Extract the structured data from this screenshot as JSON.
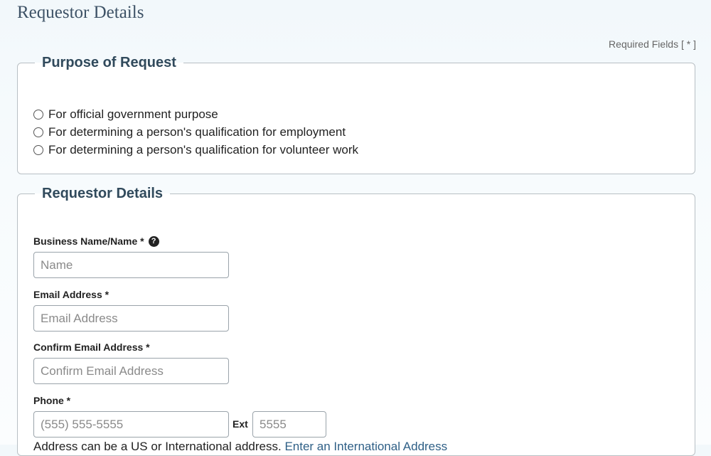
{
  "page": {
    "title": "Requestor Details",
    "required_note": "Required Fields [ * ]"
  },
  "purpose_section": {
    "legend": "Purpose of Request",
    "options": [
      {
        "label": "For official government purpose",
        "selected": false
      },
      {
        "label": "For determining a person's qualification for employment",
        "selected": false
      },
      {
        "label": "For determining a person's qualification for volunteer work",
        "selected": false
      }
    ]
  },
  "requestor_section": {
    "legend": "Requestor Details",
    "business_name": {
      "label": "Business Name/Name *",
      "placeholder": "Name",
      "help_icon": "question-circle-icon",
      "value": ""
    },
    "email": {
      "label": "Email Address *",
      "placeholder": "Email Address",
      "value": ""
    },
    "confirm_email": {
      "label": "Confirm Email Address *",
      "placeholder": "Confirm Email Address",
      "value": ""
    },
    "phone": {
      "label": "Phone *",
      "placeholder": "(555) 555-5555",
      "value": "",
      "ext_label": "Ext",
      "ext_placeholder": "5555",
      "ext_value": ""
    },
    "address_note": {
      "text": "Address can be a US or International address.",
      "link_text": "Enter an International Address"
    }
  },
  "colors": {
    "title": "#3d5266",
    "legend": "#314a5c",
    "link": "#2e5f86",
    "border": "#b8bfc4"
  }
}
